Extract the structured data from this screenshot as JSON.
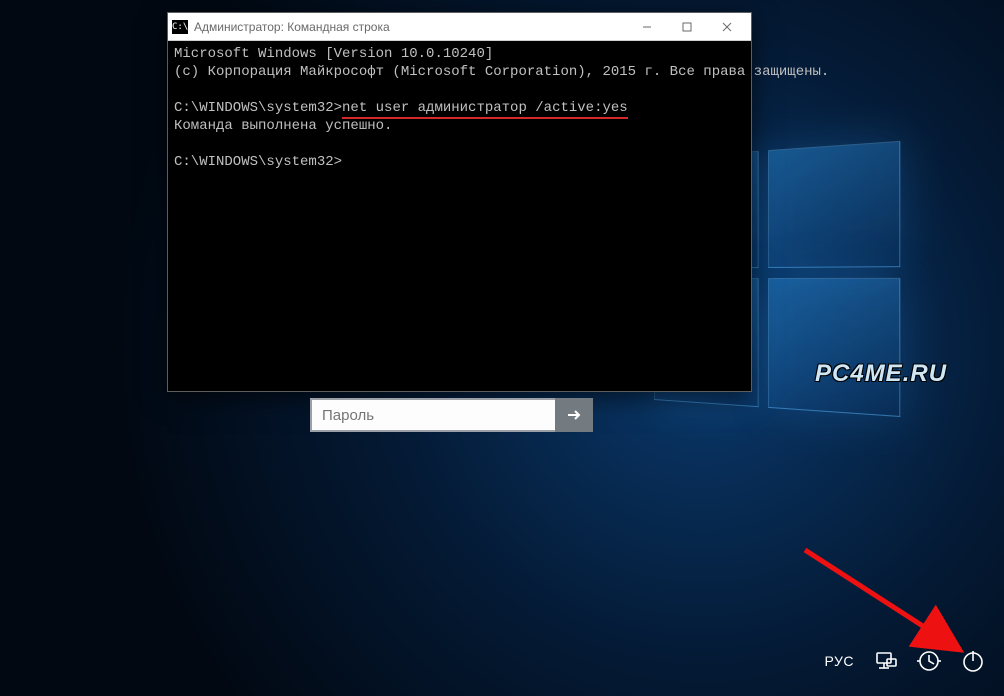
{
  "window_logo_label": "C:\\",
  "window_title": "Администратор: Командная строка",
  "console": {
    "line1": "Microsoft Windows [Version 10.0.10240]",
    "line2": "(c) Корпорация Майкрософт (Microsoft Corporation), 2015 г. Все права защищены.",
    "prompt1": "C:\\WINDOWS\\system32>",
    "command": "net user администратор /active:yes",
    "result": "Команда выполнена успешно.",
    "prompt2": "C:\\WINDOWS\\system32>"
  },
  "login": {
    "password_placeholder": "Пароль"
  },
  "corner": {
    "language": "РУС"
  },
  "watermark": "PC4ME.RU"
}
